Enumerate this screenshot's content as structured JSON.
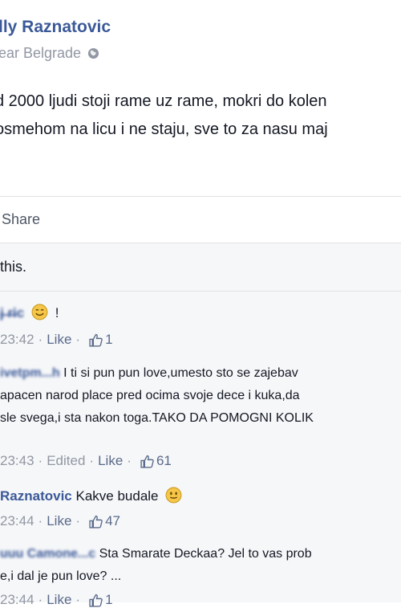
{
  "post": {
    "author": "lly Raznatovic",
    "location": "ear Belgrade",
    "line1": "d 2000 ljudi stoji rame uz rame, mokri do kolen",
    "line2": "osmehom na licu i ne staju, sve to za nasu maj"
  },
  "actions": {
    "share": "Share"
  },
  "likes_text": "this.",
  "comments": [
    {
      "name": "j̶ ̶r̶ic",
      "text": "!",
      "time": "23:42",
      "like": "Like",
      "count": "1"
    },
    {
      "name": "ivetpm...h",
      "text1": "I ti si pun pun love,umesto sto se zajebav",
      "text2": "apacen narod place pred ocima svoje dece i kuka,da",
      "text3": "sle svega,i sta nakon toga.TAKO DA POMOGNI KOLIK",
      "time": "23:43",
      "edited": "Edited",
      "like": "Like",
      "count": "61"
    },
    {
      "name": "Raznatovic",
      "text": "Kakve budale",
      "time": "23:44",
      "like": "Like",
      "count": "47"
    },
    {
      "name": "uuu Camone...c",
      "text1": "Sta Smarate Deckaa? Jel to vas prob",
      "text2": "e,i dal je pun love? ...",
      "time": "23:44",
      "like": "Like",
      "count": "1"
    }
  ],
  "colors": {
    "link": "#3b5998",
    "meta": "#9197a3",
    "divider": "#e1e2e3",
    "emoji": "#f5c64a"
  }
}
